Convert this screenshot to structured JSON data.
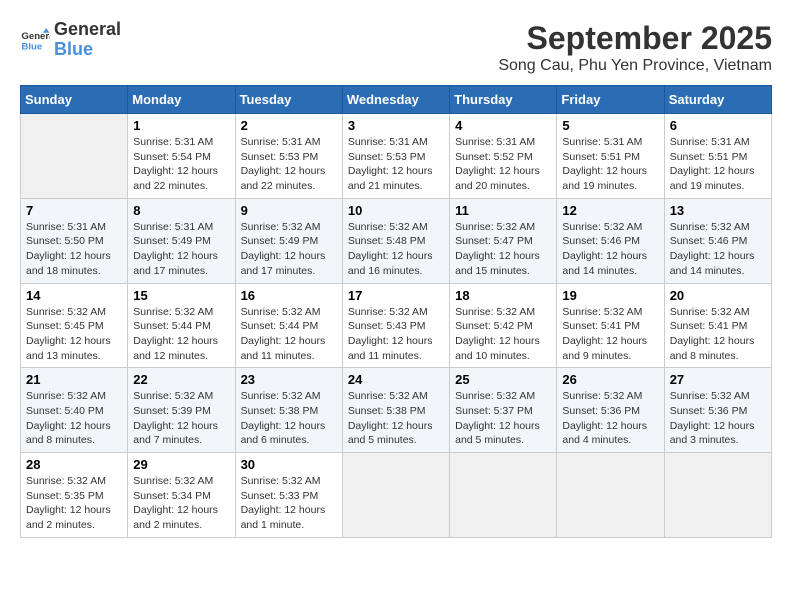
{
  "header": {
    "logo_line1": "General",
    "logo_line2": "Blue",
    "month_title": "September 2025",
    "location": "Song Cau, Phu Yen Province, Vietnam"
  },
  "weekdays": [
    "Sunday",
    "Monday",
    "Tuesday",
    "Wednesday",
    "Thursday",
    "Friday",
    "Saturday"
  ],
  "weeks": [
    [
      {
        "day": "",
        "empty": true
      },
      {
        "day": "1",
        "sunrise": "5:31 AM",
        "sunset": "5:54 PM",
        "daylight": "12 hours and 22 minutes."
      },
      {
        "day": "2",
        "sunrise": "5:31 AM",
        "sunset": "5:53 PM",
        "daylight": "12 hours and 22 minutes."
      },
      {
        "day": "3",
        "sunrise": "5:31 AM",
        "sunset": "5:53 PM",
        "daylight": "12 hours and 21 minutes."
      },
      {
        "day": "4",
        "sunrise": "5:31 AM",
        "sunset": "5:52 PM",
        "daylight": "12 hours and 20 minutes."
      },
      {
        "day": "5",
        "sunrise": "5:31 AM",
        "sunset": "5:51 PM",
        "daylight": "12 hours and 19 minutes."
      },
      {
        "day": "6",
        "sunrise": "5:31 AM",
        "sunset": "5:51 PM",
        "daylight": "12 hours and 19 minutes."
      }
    ],
    [
      {
        "day": "7",
        "sunrise": "5:31 AM",
        "sunset": "5:50 PM",
        "daylight": "12 hours and 18 minutes."
      },
      {
        "day": "8",
        "sunrise": "5:31 AM",
        "sunset": "5:49 PM",
        "daylight": "12 hours and 17 minutes."
      },
      {
        "day": "9",
        "sunrise": "5:32 AM",
        "sunset": "5:49 PM",
        "daylight": "12 hours and 17 minutes."
      },
      {
        "day": "10",
        "sunrise": "5:32 AM",
        "sunset": "5:48 PM",
        "daylight": "12 hours and 16 minutes."
      },
      {
        "day": "11",
        "sunrise": "5:32 AM",
        "sunset": "5:47 PM",
        "daylight": "12 hours and 15 minutes."
      },
      {
        "day": "12",
        "sunrise": "5:32 AM",
        "sunset": "5:46 PM",
        "daylight": "12 hours and 14 minutes."
      },
      {
        "day": "13",
        "sunrise": "5:32 AM",
        "sunset": "5:46 PM",
        "daylight": "12 hours and 14 minutes."
      }
    ],
    [
      {
        "day": "14",
        "sunrise": "5:32 AM",
        "sunset": "5:45 PM",
        "daylight": "12 hours and 13 minutes."
      },
      {
        "day": "15",
        "sunrise": "5:32 AM",
        "sunset": "5:44 PM",
        "daylight": "12 hours and 12 minutes."
      },
      {
        "day": "16",
        "sunrise": "5:32 AM",
        "sunset": "5:44 PM",
        "daylight": "12 hours and 11 minutes."
      },
      {
        "day": "17",
        "sunrise": "5:32 AM",
        "sunset": "5:43 PM",
        "daylight": "12 hours and 11 minutes."
      },
      {
        "day": "18",
        "sunrise": "5:32 AM",
        "sunset": "5:42 PM",
        "daylight": "12 hours and 10 minutes."
      },
      {
        "day": "19",
        "sunrise": "5:32 AM",
        "sunset": "5:41 PM",
        "daylight": "12 hours and 9 minutes."
      },
      {
        "day": "20",
        "sunrise": "5:32 AM",
        "sunset": "5:41 PM",
        "daylight": "12 hours and 8 minutes."
      }
    ],
    [
      {
        "day": "21",
        "sunrise": "5:32 AM",
        "sunset": "5:40 PM",
        "daylight": "12 hours and 8 minutes."
      },
      {
        "day": "22",
        "sunrise": "5:32 AM",
        "sunset": "5:39 PM",
        "daylight": "12 hours and 7 minutes."
      },
      {
        "day": "23",
        "sunrise": "5:32 AM",
        "sunset": "5:38 PM",
        "daylight": "12 hours and 6 minutes."
      },
      {
        "day": "24",
        "sunrise": "5:32 AM",
        "sunset": "5:38 PM",
        "daylight": "12 hours and 5 minutes."
      },
      {
        "day": "25",
        "sunrise": "5:32 AM",
        "sunset": "5:37 PM",
        "daylight": "12 hours and 5 minutes."
      },
      {
        "day": "26",
        "sunrise": "5:32 AM",
        "sunset": "5:36 PM",
        "daylight": "12 hours and 4 minutes."
      },
      {
        "day": "27",
        "sunrise": "5:32 AM",
        "sunset": "5:36 PM",
        "daylight": "12 hours and 3 minutes."
      }
    ],
    [
      {
        "day": "28",
        "sunrise": "5:32 AM",
        "sunset": "5:35 PM",
        "daylight": "12 hours and 2 minutes."
      },
      {
        "day": "29",
        "sunrise": "5:32 AM",
        "sunset": "5:34 PM",
        "daylight": "12 hours and 2 minutes."
      },
      {
        "day": "30",
        "sunrise": "5:32 AM",
        "sunset": "5:33 PM",
        "daylight": "12 hours and 1 minute."
      },
      {
        "day": "",
        "empty": true
      },
      {
        "day": "",
        "empty": true
      },
      {
        "day": "",
        "empty": true
      },
      {
        "day": "",
        "empty": true
      }
    ]
  ]
}
